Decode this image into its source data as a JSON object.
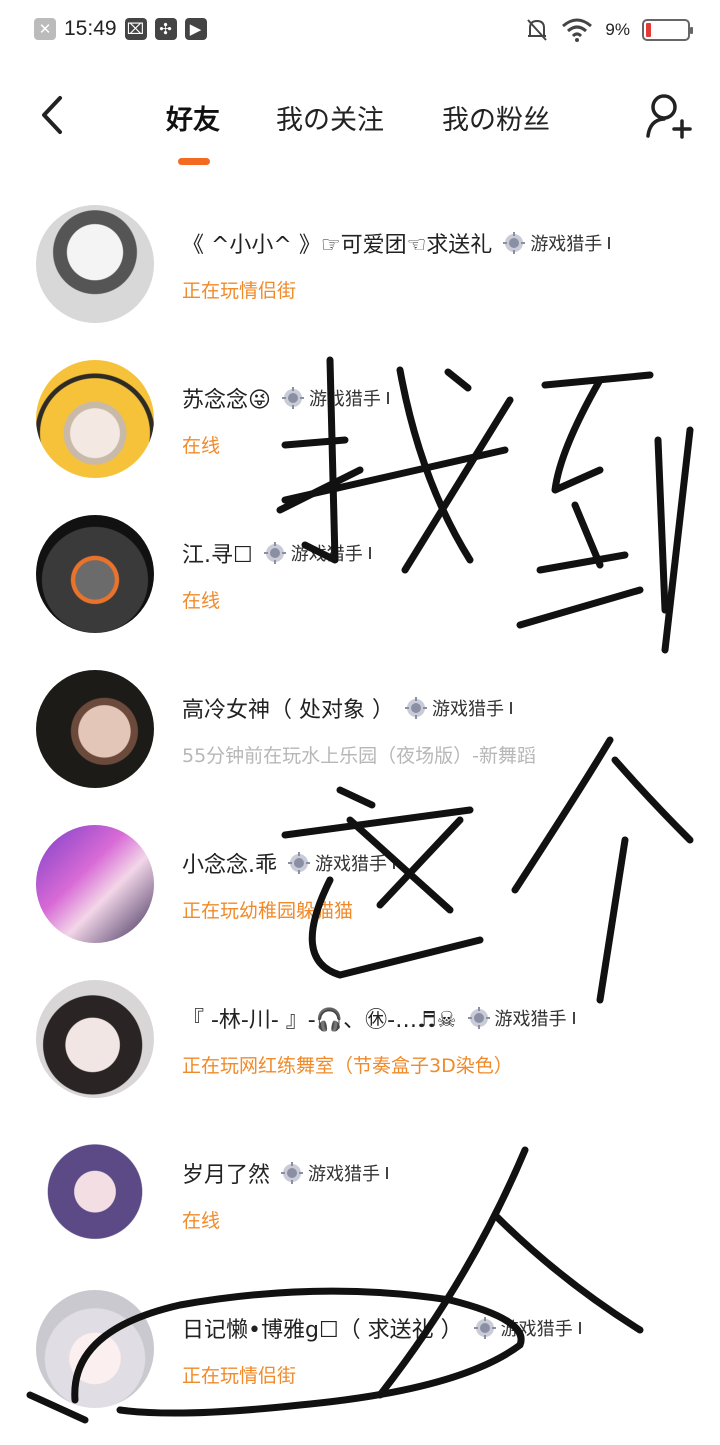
{
  "status_bar": {
    "time": "15:49",
    "battery": "9%"
  },
  "header": {
    "tabs": [
      {
        "label": "好友",
        "active": true
      },
      {
        "label": "我の关注",
        "active": false
      },
      {
        "label": "我の粉丝",
        "active": false
      }
    ]
  },
  "friends": [
    {
      "name": "《 ^小小^ 》☞可爱团☜求送礼",
      "badge": "游戏猎手",
      "status": "正在玩情侣街",
      "status_color": "orange"
    },
    {
      "name": "苏念念😜",
      "badge": "游戏猎手",
      "status": "在线",
      "status_color": "orange"
    },
    {
      "name": "江.寻☐",
      "badge": "游戏猎手",
      "status": "在线",
      "status_color": "orange"
    },
    {
      "name": "高冷女神（ 处对象 ）",
      "badge": "游戏猎手",
      "status": "55分钟前在玩水上乐园（夜场版）-新舞蹈",
      "status_color": "gray"
    },
    {
      "name": "小念念.乖",
      "badge": "游戏猎手",
      "status": "正在玩幼稚园躲猫猫",
      "status_color": "orange"
    },
    {
      "name": "『 -林-川- 』-🎧、㊡-…♬☠",
      "badge": "游戏猎手",
      "status": "正在玩网红练舞室（节奏盒子3D染色）",
      "status_color": "orange"
    },
    {
      "name": "岁月了然",
      "badge": "游戏猎手",
      "status": "在线",
      "status_color": "orange"
    },
    {
      "name": "日记懒•博雅g☐（ 求送礼 ）",
      "badge": "游戏猎手",
      "status": "正在玩情侣街",
      "status_color": "orange"
    }
  ],
  "colors": {
    "accent": "#f36b21",
    "status_orange": "#f08a2a",
    "status_gray": "#b7b7b7"
  }
}
